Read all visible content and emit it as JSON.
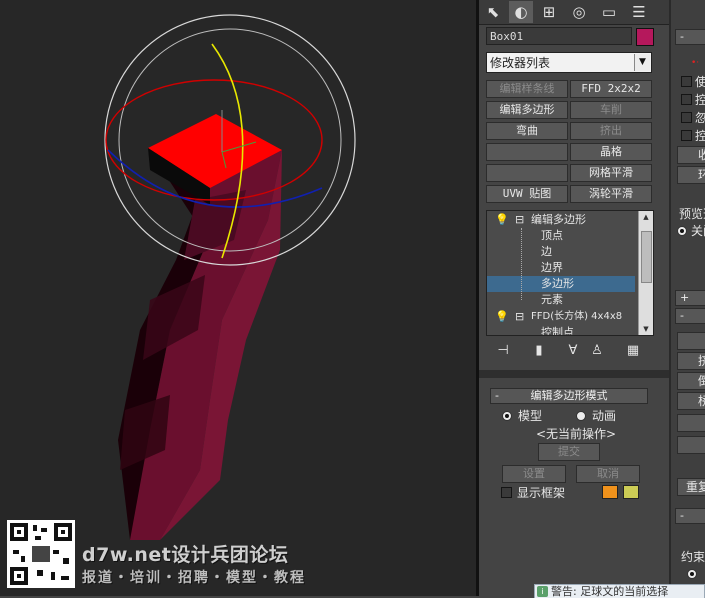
{
  "watermark": {
    "title": "d7w.net设计兵团论坛",
    "subtitle": "报道・培训・招聘・模型・教程"
  },
  "command_panel": {
    "tabs": [
      "create-icon",
      "modify-icon",
      "hierarchy-icon",
      "motion-icon",
      "display-icon",
      "utilities-icon"
    ],
    "object_name": "Box01",
    "object_color": "#b5185c",
    "modifier_list": "修改器列表",
    "modifier_buttons": [
      {
        "label": "编辑样条线",
        "enabled": false
      },
      {
        "label": "FFD 2x2x2",
        "enabled": true
      },
      {
        "label": "编辑多边形",
        "enabled": true
      },
      {
        "label": "车削",
        "enabled": false
      },
      {
        "label": "弯曲",
        "enabled": true
      },
      {
        "label": "挤出",
        "enabled": false
      },
      {
        "label": "",
        "enabled": true
      },
      {
        "label": "晶格",
        "enabled": true
      },
      {
        "label": "",
        "enabled": true
      },
      {
        "label": "网格平滑",
        "enabled": true
      },
      {
        "label": "UVW 贴图",
        "enabled": true
      },
      {
        "label": "涡轮平滑",
        "enabled": true
      }
    ],
    "stack": [
      {
        "label": "编辑多边形",
        "level": 0,
        "expander": "⊟",
        "selected": false
      },
      {
        "label": "顶点",
        "level": 1,
        "selected": false
      },
      {
        "label": "边",
        "level": 1,
        "selected": false
      },
      {
        "label": "边界",
        "level": 1,
        "selected": false
      },
      {
        "label": "多边形",
        "level": 1,
        "selected": true
      },
      {
        "label": "元素",
        "level": 1,
        "selected": false
      },
      {
        "label": "FFD(长方体) 4x4x8",
        "level": 0,
        "expander": "⊟",
        "selected": false
      },
      {
        "label": "控制点",
        "level": 1,
        "selected": false
      }
    ],
    "stack_tools": [
      "pin-stack-icon",
      "show-end-result-icon",
      "make-unique-icon",
      "remove-modifier-icon",
      "configure-sets-icon"
    ],
    "edit_poly_mode": {
      "title": "编辑多边形模式",
      "collapse": "-",
      "options": [
        {
          "label": "模型",
          "selected": true
        },
        {
          "label": "动画",
          "selected": false
        }
      ],
      "status": "<无当前操作>",
      "commit": "提交",
      "settings": "设置",
      "cancel": "取消",
      "show_cage": "显示框架",
      "cage_colors": [
        "#f0921c",
        "#cccc55"
      ]
    }
  },
  "right_panel": {
    "head1": "-",
    "checks": [
      "使",
      "控",
      "忽",
      "控"
    ],
    "button1": "收",
    "button2": "环",
    "preview_label": "预览选",
    "preview_option": "关闭",
    "plus": "+",
    "head2": "-",
    "buttons": [
      "挤",
      "倒",
      "桥",
      "",
      "",
      "重复"
    ],
    "head3": "-",
    "constraint": "约束"
  },
  "warning": {
    "icon": "info-icon",
    "text": "警告: 足球文的当前选择"
  }
}
